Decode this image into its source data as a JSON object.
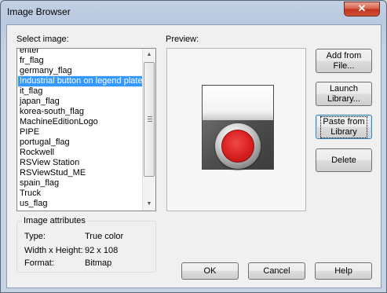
{
  "window": {
    "title": "Image Browser",
    "close_glyph": "✕"
  },
  "select_label": "Select image:",
  "preview_label": "Preview:",
  "image_list": {
    "items": [
      "enter",
      "fr_flag",
      "germany_flag",
      "Industrial button on legend plate",
      "it_flag",
      "japan_flag",
      "korea-south_flag",
      "MachineEditionLogo",
      "PIPE",
      "portugal_flag",
      "Rockwell",
      "RSView Station",
      "RSViewStud_ME",
      "spain_flag",
      "Truck",
      "us_flag"
    ],
    "selected": "Industrial button on legend plate"
  },
  "attributes": {
    "legend": "Image attributes",
    "rows": [
      {
        "label": "Type:",
        "value": "True color"
      },
      {
        "label": "Width x Height:",
        "value": "92 x 108"
      },
      {
        "label": "Format:",
        "value": "Bitmap"
      }
    ]
  },
  "buttons": {
    "add_from_file": [
      "Add from",
      "File..."
    ],
    "launch_library": [
      "Launch",
      "Library..."
    ],
    "paste_from_library": [
      "Paste from",
      "Library"
    ],
    "delete": "Delete",
    "ok": "OK",
    "cancel": "Cancel",
    "help": "Help"
  },
  "icons": {
    "close": "close-icon",
    "scroll_up": "chevron-up-icon",
    "scroll_down": "chevron-down-icon",
    "scroll_grip": "grip-icon"
  }
}
